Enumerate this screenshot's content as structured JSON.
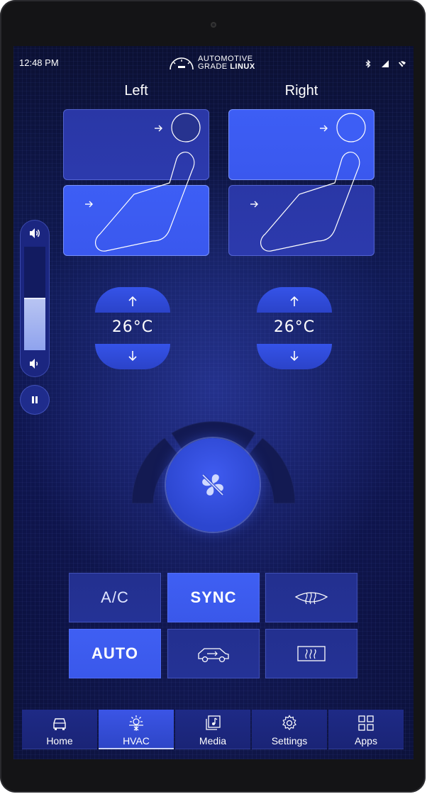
{
  "status_bar": {
    "time": "12:48 PM",
    "logo_line1": "AUTOMOTIVE",
    "logo_line2_a": "GRADE ",
    "logo_line2_b": "LINUX",
    "icons": [
      "bluetooth-icon",
      "signal-icon",
      "wifi-off-icon"
    ]
  },
  "zones": {
    "left": {
      "title": "Left",
      "temperature": "26°C"
    },
    "right": {
      "title": "Right",
      "temperature": "26°C"
    }
  },
  "volume": {
    "level": 0.49
  },
  "fan": {
    "icon": "fan-off-icon",
    "speed_segments": 3
  },
  "controls": {
    "ac": "A/C",
    "sync": "SYNC",
    "auto": "AUTO",
    "front_defrost_icon": "front-defrost-icon",
    "recirculation_icon": "car-recirculation-icon",
    "rear_defrost_icon": "rear-defrost-icon"
  },
  "nav": {
    "items": [
      {
        "label": "Home",
        "icon": "car-icon"
      },
      {
        "label": "HVAC",
        "icon": "hvac-icon"
      },
      {
        "label": "Media",
        "icon": "media-icon"
      },
      {
        "label": "Settings",
        "icon": "gear-icon"
      },
      {
        "label": "Apps",
        "icon": "apps-grid-icon"
      }
    ],
    "active": "HVAC"
  },
  "colors": {
    "accent": "#3d5ef5",
    "dim_panel": "#2a37a6",
    "background": "#0f1650"
  }
}
